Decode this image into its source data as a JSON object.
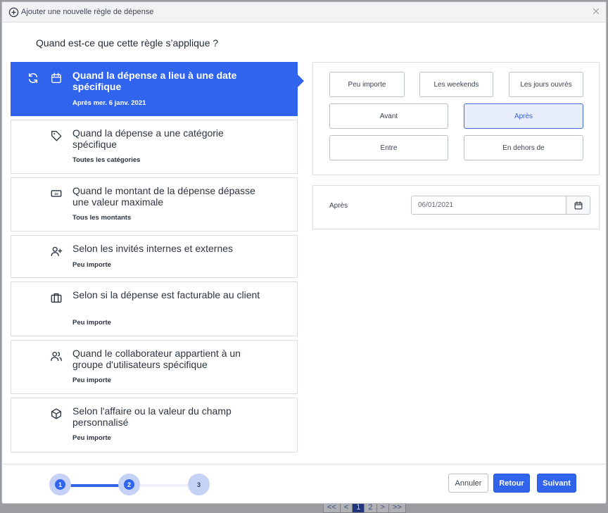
{
  "modal": {
    "title": "Ajouter une nouvelle règle de dépense",
    "question": "Quand est-ce que cette règle s’applique ?"
  },
  "rules": [
    {
      "title": "Quand la dépense a lieu à une date spécifique",
      "subtitle": "Après mer. 6 janv. 2021",
      "icon": "calendar-icon",
      "active": true
    },
    {
      "title": "Quand la dépense a une catégorie spécifique",
      "subtitle": "Toutes les catégories",
      "icon": "tag-icon"
    },
    {
      "title": "Quand le montant de la dépense dépasse une valeur maximale",
      "subtitle": "Tous les montants",
      "icon": "banknote-icon"
    },
    {
      "title": "Selon les invités internes et externes",
      "subtitle": "Peu importe",
      "icon": "user-plus-icon"
    },
    {
      "title": "Selon si la dépense est facturable au client",
      "subtitle": "Peu importe",
      "icon": "briefcase-icon"
    },
    {
      "title": "Quand le collaborateur appartient à un groupe d'utilisateurs spécifique",
      "subtitle": "Peu importe",
      "icon": "users-icon"
    },
    {
      "title": "Selon l'affaire ou la valeur du champ personnalisé",
      "subtitle": "Peu importe",
      "icon": "box-icon"
    }
  ],
  "date_options": {
    "peu_importe": "Peu importe",
    "weekends": "Les weekends",
    "jours_ouvres": "Les jours ouvrés",
    "avant": "Avant",
    "apres": "Après",
    "entre": "Entre",
    "en_dehors": "En dehors de",
    "selected": "Après"
  },
  "date_field": {
    "label": "Après",
    "value": "06/01/2021"
  },
  "stepper": {
    "steps": [
      "1",
      "2",
      "3"
    ],
    "current": 2
  },
  "buttons": {
    "cancel": "Annuler",
    "back": "Retour",
    "next": "Suivant"
  },
  "background_pager": [
    "<<",
    "<",
    "1",
    "2",
    ">",
    ">>"
  ],
  "colors": {
    "accent": "#3064ec",
    "selected_bg": "#e9eefd",
    "step_track": "#c5d2f5"
  }
}
